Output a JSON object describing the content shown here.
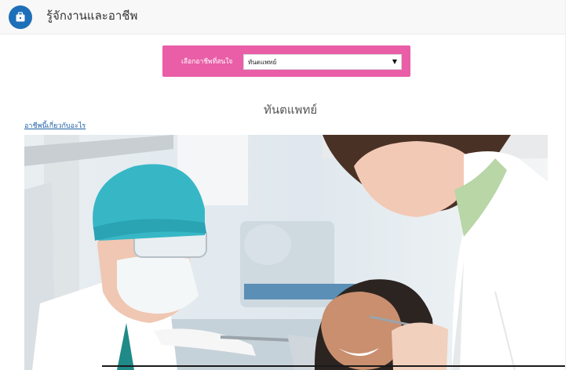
{
  "header": {
    "title": "รู้จักงานและอาชีพ",
    "icon": "briefcase-icon"
  },
  "career_select": {
    "label": "เลือกอาชีพที่สนใจ",
    "selected": "ทันตแพทย์",
    "options": [
      "ทันตแพทย์"
    ]
  },
  "career": {
    "title": "ทันตแพทย์",
    "about_link": "อาชีพนี้เกี่ยวกับอะไร"
  },
  "colors": {
    "select_bar": "#e95ea7",
    "header_icon": "#1d6fb8",
    "link": "#1d5fa8"
  }
}
